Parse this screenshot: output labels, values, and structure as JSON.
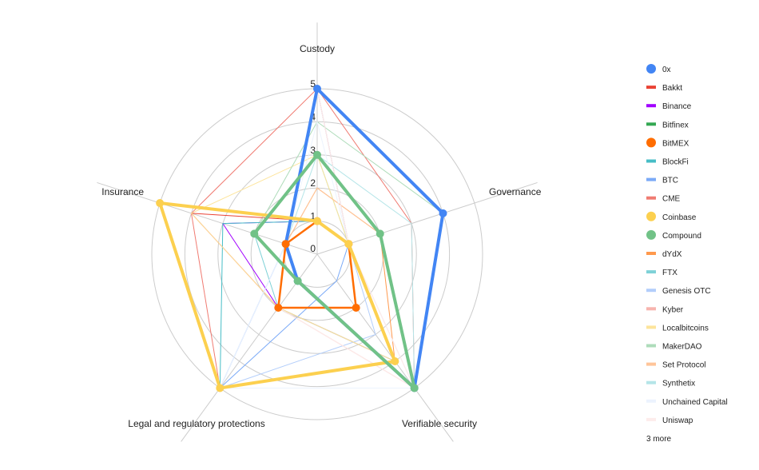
{
  "chart_data": {
    "type": "radar",
    "axes": [
      "Custody",
      "Governance",
      "Verifiable security",
      "Legal and regulatory protections",
      "Insurance"
    ],
    "rlim": [
      0,
      5
    ],
    "ticks": [
      "0",
      "1",
      "2",
      "3",
      "4",
      "5"
    ],
    "grid": true,
    "legend_position": "right",
    "legend_more": "3 more",
    "series": [
      {
        "name": "0x",
        "color": "#4285f4",
        "values": [
          5,
          4,
          5,
          1,
          1
        ],
        "highlight": true
      },
      {
        "name": "Bakkt",
        "color": "#ea4335",
        "values": [
          1,
          1,
          2,
          2,
          4
        ]
      },
      {
        "name": "Binance",
        "color": "#a100ff",
        "values": [
          1,
          1,
          4,
          2,
          3
        ]
      },
      {
        "name": "Bitfinex",
        "color": "#34a853",
        "values": [
          3,
          2,
          5,
          1,
          2
        ]
      },
      {
        "name": "BitMEX",
        "color": "#ff6d00",
        "values": [
          1,
          1,
          2,
          2,
          1
        ],
        "highlight": true
      },
      {
        "name": "BlockFi",
        "color": "#46bdc6",
        "values": [
          1,
          1,
          4,
          5,
          3
        ]
      },
      {
        "name": "BTC",
        "color": "#7baaf7",
        "values": [
          5,
          1,
          1,
          5,
          1
        ]
      },
      {
        "name": "CME",
        "color": "#f07b72",
        "values": [
          5,
          3,
          5,
          5,
          4
        ]
      },
      {
        "name": "Coinbase",
        "color": "#fcd04f",
        "values": [
          1,
          1,
          4,
          5,
          5
        ],
        "highlight": true
      },
      {
        "name": "Compound",
        "color": "#71c287",
        "values": [
          3,
          2,
          5,
          1,
          2
        ],
        "highlight": true
      },
      {
        "name": "dYdX",
        "color": "#ff994d",
        "values": [
          2,
          2,
          4,
          2,
          1
        ]
      },
      {
        "name": "FTX",
        "color": "#7ed1d7",
        "values": [
          3,
          1,
          4,
          2,
          2
        ]
      },
      {
        "name": "Genesis OTC",
        "color": "#b3cefb",
        "values": [
          1,
          1,
          3,
          5,
          1
        ]
      },
      {
        "name": "Kyber",
        "color": "#f7b4ae",
        "values": [
          5,
          1,
          5,
          2,
          1
        ]
      },
      {
        "name": "Localbitcoins",
        "color": "#fde49b",
        "values": [
          3,
          1,
          4,
          2,
          4
        ]
      },
      {
        "name": "MakerDAO",
        "color": "#aedcba",
        "values": [
          4,
          4,
          5,
          1,
          2
        ]
      },
      {
        "name": "Set Protocol",
        "color": "#ffc599",
        "values": [
          2,
          2,
          5,
          1,
          1
        ]
      },
      {
        "name": "Synthetix",
        "color": "#b5e5e8",
        "values": [
          3,
          3,
          5,
          1,
          1
        ]
      },
      {
        "name": "Unchained Capital",
        "color": "#ecf3fe",
        "values": [
          4,
          1,
          5,
          5,
          1
        ]
      },
      {
        "name": "Uniswap",
        "color": "#fdeceb",
        "values": [
          5,
          1,
          5,
          2,
          1
        ]
      }
    ]
  }
}
